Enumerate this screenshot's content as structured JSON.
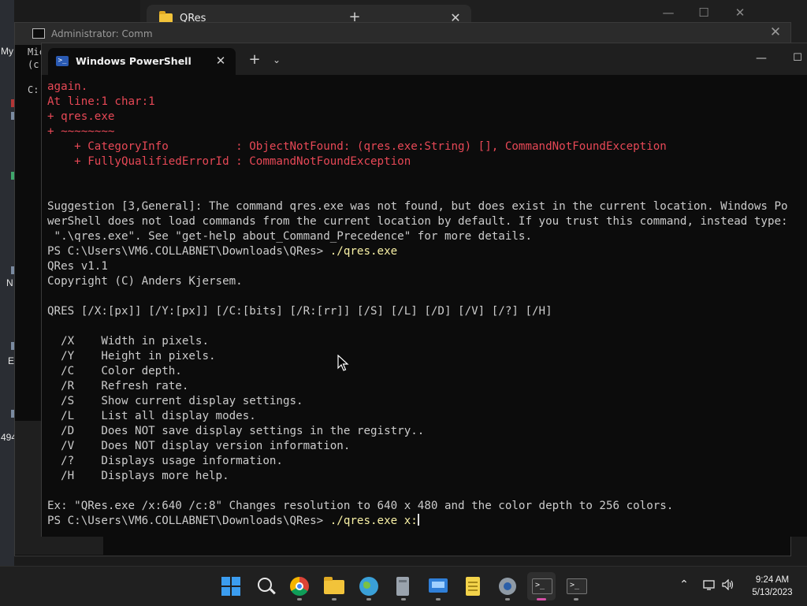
{
  "desktop": {
    "labels": [
      "My",
      "N",
      "E",
      "494"
    ]
  },
  "explorer": {
    "tab_title": "QRes",
    "tab_close": "✕",
    "new_tab": "+",
    "minimize": "—",
    "maximize": "☐",
    "close": "✕"
  },
  "cmd_window": {
    "title": "Administrator: Comm",
    "close": "✕",
    "peek_lines": [
      "Mic",
      "(c",
      "",
      "C:"
    ]
  },
  "terminal": {
    "tab_title": "Windows PowerShell",
    "tab_close": "✕",
    "new_tab": "+",
    "dropdown": "⌄",
    "minimize": "—",
    "maximize": "☐",
    "lines": [
      {
        "text": "again.",
        "kind": "err"
      },
      {
        "text": "At line:1 char:1",
        "kind": "err"
      },
      {
        "text": "+ qres.exe",
        "kind": "err"
      },
      {
        "text": "+ ~~~~~~~~",
        "kind": "err"
      },
      {
        "text": "    + CategoryInfo          : ObjectNotFound: (qres.exe:String) [], CommandNotFoundException",
        "kind": "err"
      },
      {
        "text": "    + FullyQualifiedErrorId : CommandNotFoundException",
        "kind": "err"
      },
      {
        "text": "",
        "kind": "out"
      },
      {
        "text": "",
        "kind": "out"
      },
      {
        "text": "Suggestion [3,General]: The command qres.exe was not found, but does exist in the current location. Windows Po",
        "kind": "out"
      },
      {
        "text": "werShell does not load commands from the current location by default. If you trust this command, instead type:",
        "kind": "out"
      },
      {
        "text": " \".\\qres.exe\". See \"get-help about_Command_Precedence\" for more details.",
        "kind": "out"
      },
      {
        "text": "PS C:\\Users\\VM6.COLLABNET\\Downloads\\QRes> ",
        "cmd": "./qres.exe",
        "kind": "prompt"
      },
      {
        "text": "QRes v1.1",
        "kind": "out"
      },
      {
        "text": "Copyright (C) Anders Kjersem.",
        "kind": "out"
      },
      {
        "text": "",
        "kind": "out"
      },
      {
        "text": "QRES [/X:[px]] [/Y:[px]] [/C:[bits] [/R:[rr]] [/S] [/L] [/D] [/V] [/?] [/H]",
        "kind": "out"
      },
      {
        "text": "",
        "kind": "out"
      },
      {
        "text": "  /X    Width in pixels.",
        "kind": "out"
      },
      {
        "text": "  /Y    Height in pixels.",
        "kind": "out"
      },
      {
        "text": "  /C    Color depth.",
        "kind": "out"
      },
      {
        "text": "  /R    Refresh rate.",
        "kind": "out"
      },
      {
        "text": "  /S    Show current display settings.",
        "kind": "out"
      },
      {
        "text": "  /L    List all display modes.",
        "kind": "out"
      },
      {
        "text": "  /D    Does NOT save display settings in the registry..",
        "kind": "out"
      },
      {
        "text": "  /V    Does NOT display version information.",
        "kind": "out"
      },
      {
        "text": "  /?    Displays usage information.",
        "kind": "out"
      },
      {
        "text": "  /H    Displays more help.",
        "kind": "out"
      },
      {
        "text": "",
        "kind": "out"
      },
      {
        "text": "Ex: \"QRes.exe /x:640 /c:8\" Changes resolution to 640 x 480 and the color depth to 256 colors.",
        "kind": "out"
      },
      {
        "text": "PS C:\\Users\\VM6.COLLABNET\\Downloads\\QRes> ",
        "cmd": "./qres.exe x:",
        "kind": "prompt",
        "cursor": true
      }
    ]
  },
  "colors": {
    "error": "#e74856",
    "output": "#cccccc",
    "command": "#f9f1a5",
    "background": "#0c0c0c"
  },
  "taskbar": {
    "apps": [
      {
        "name": "start",
        "icon": "windows-start-icon"
      },
      {
        "name": "search",
        "icon": "search-icon"
      },
      {
        "name": "chrome",
        "icon": "chrome-icon"
      },
      {
        "name": "file-explorer",
        "icon": "folder-icon"
      },
      {
        "name": "browser",
        "icon": "globe-icon"
      },
      {
        "name": "drive",
        "icon": "drive-icon"
      },
      {
        "name": "remote-desktop",
        "icon": "monitor-icon"
      },
      {
        "name": "notepad",
        "icon": "notepad-icon"
      },
      {
        "name": "settings",
        "icon": "gear-icon"
      },
      {
        "name": "terminal",
        "icon": "terminal-icon",
        "active": true
      },
      {
        "name": "terminal-2",
        "icon": "terminal-icon"
      }
    ],
    "tray": {
      "chevron": "⌃",
      "network": "▭",
      "volume": "🔊"
    },
    "clock": {
      "time": "9:24 AM",
      "date": "5/13/2023"
    }
  }
}
